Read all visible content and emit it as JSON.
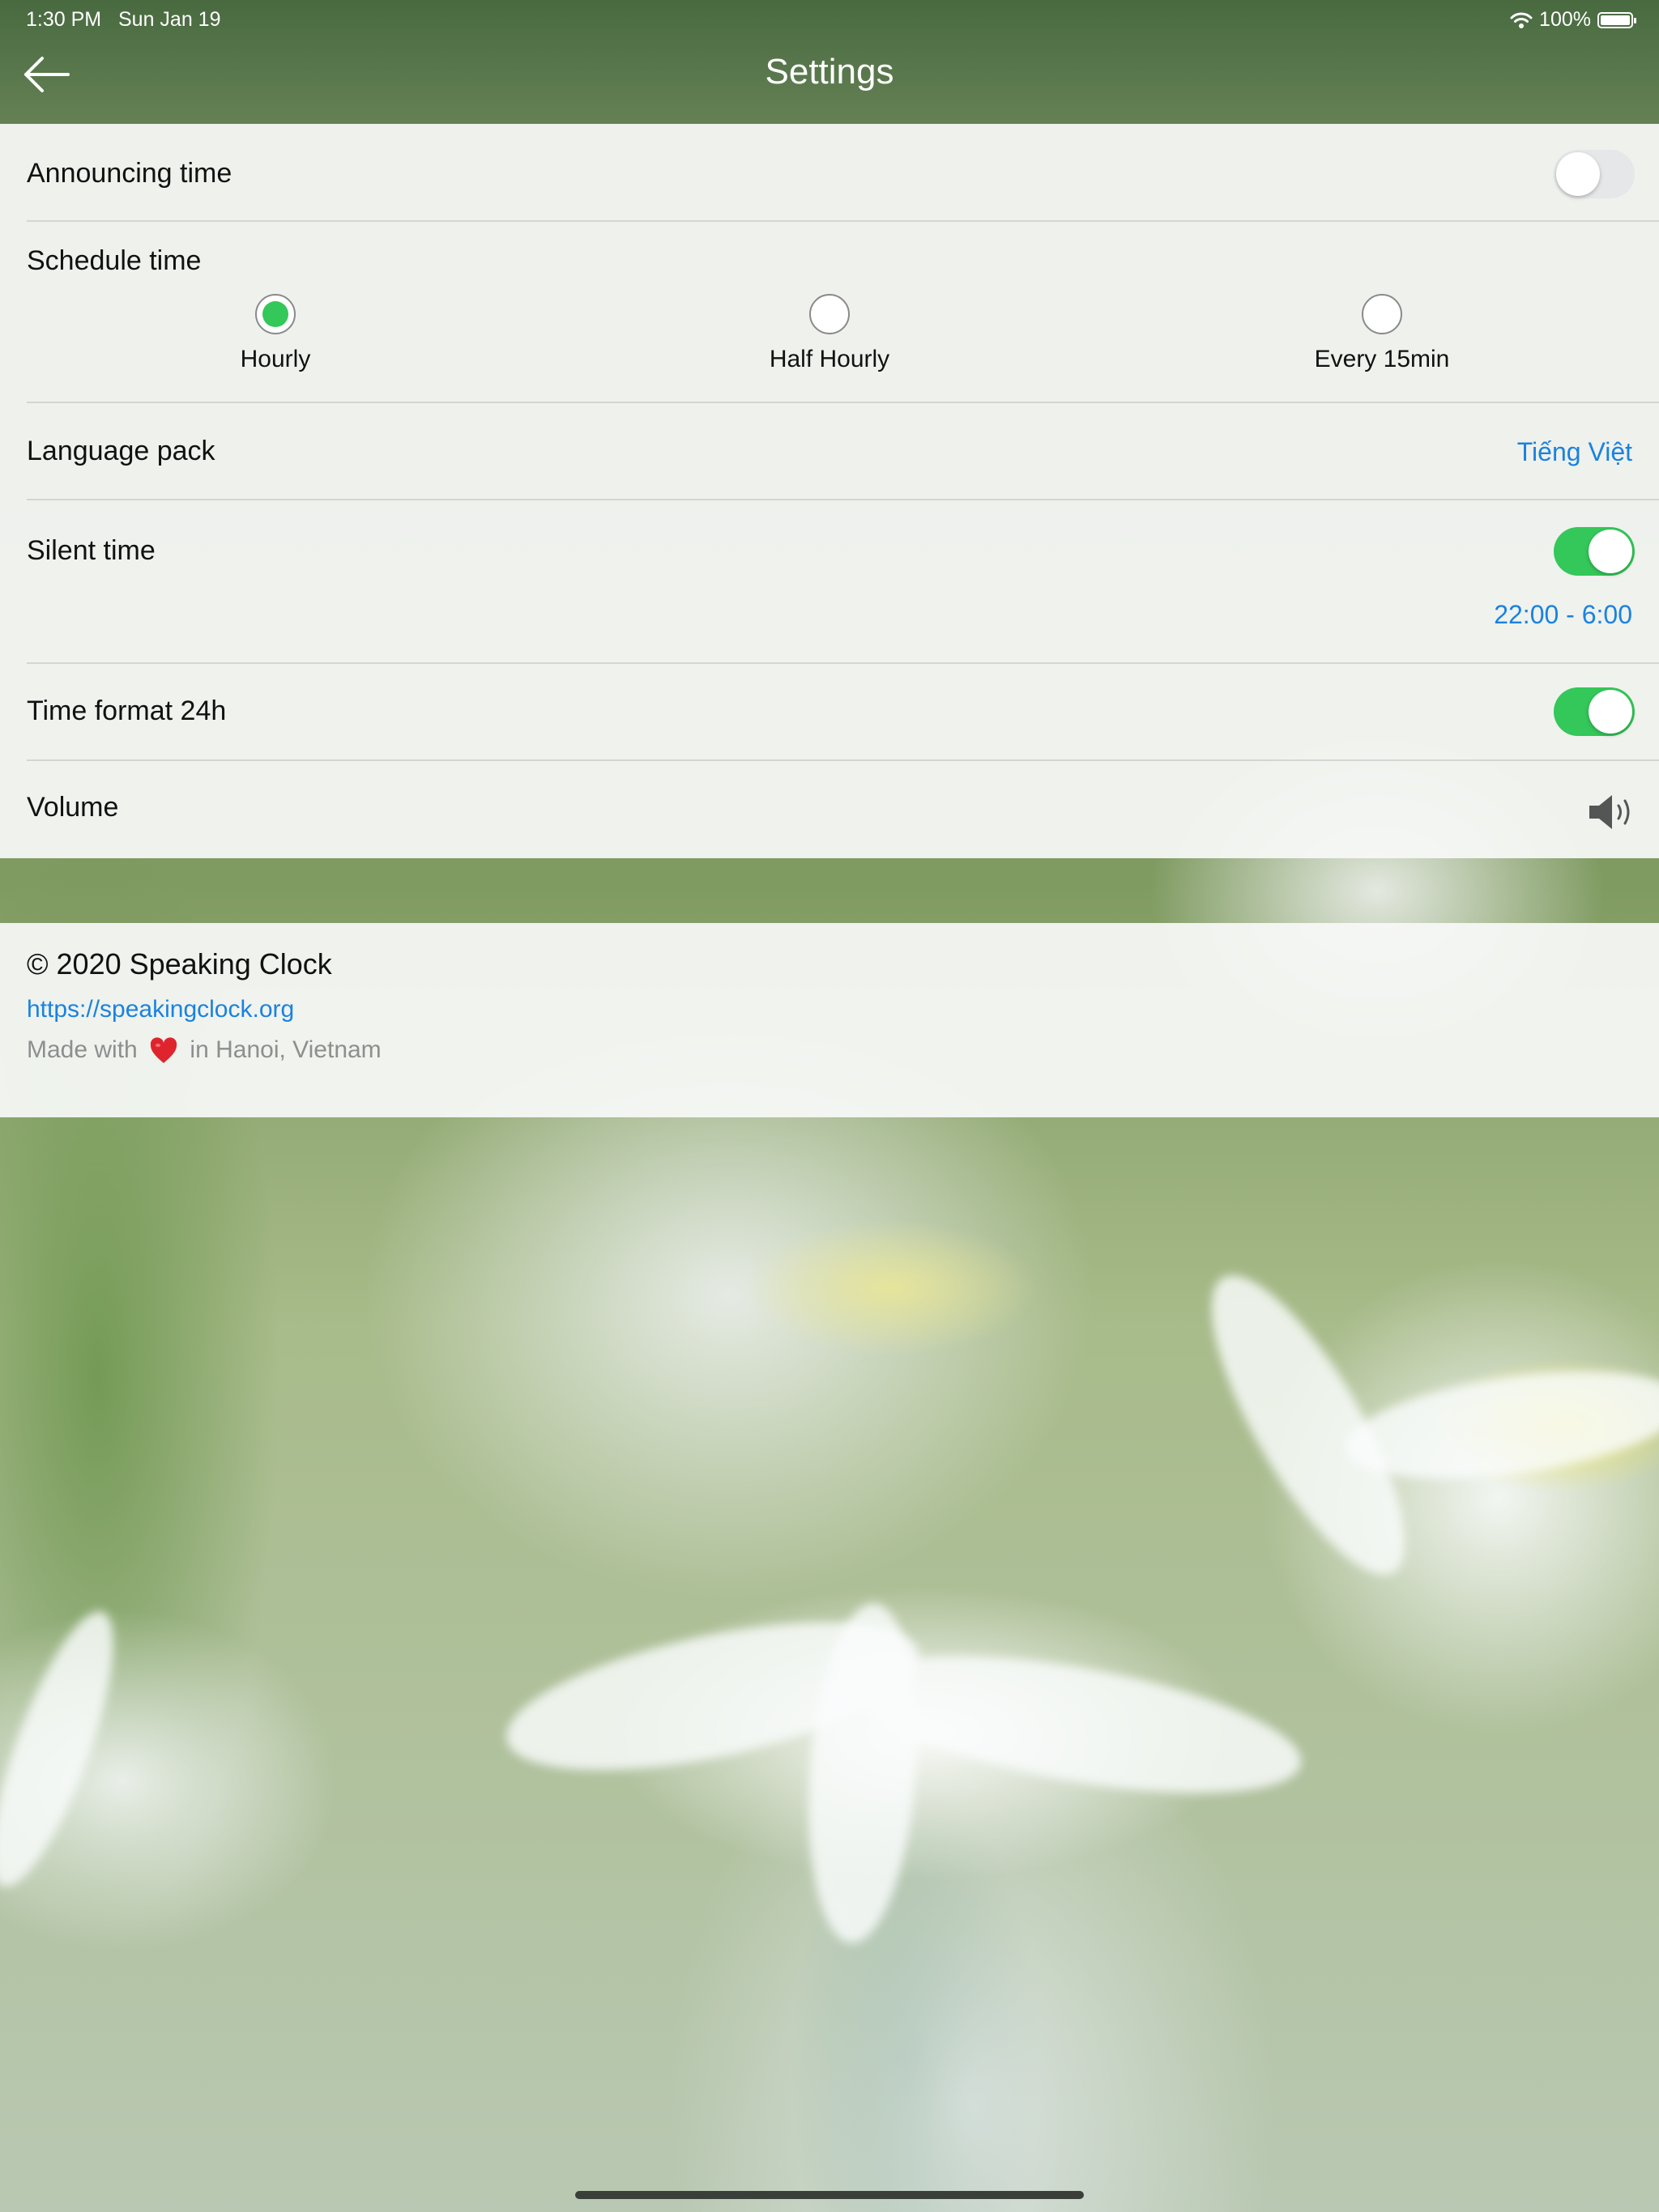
{
  "status_bar": {
    "time": "1:30 PM",
    "date": "Sun Jan 19",
    "battery": "100%"
  },
  "nav": {
    "title": "Settings"
  },
  "settings": {
    "announcing": {
      "label": "Announcing time",
      "enabled": false
    },
    "schedule": {
      "label": "Schedule time",
      "options": [
        {
          "label": "Hourly",
          "selected": true
        },
        {
          "label": "Half Hourly",
          "selected": false
        },
        {
          "label": "Every 15min",
          "selected": false
        }
      ]
    },
    "language": {
      "label": "Language pack",
      "value": "Tiếng Việt"
    },
    "silent": {
      "label": "Silent time",
      "enabled": true,
      "range": "22:00 - 6:00"
    },
    "format": {
      "label": "Time format 24h",
      "enabled": true
    },
    "volume": {
      "label": "Volume"
    }
  },
  "footer": {
    "copyright": "© 2020 Speaking Clock",
    "url": "https://speakingclock.org",
    "made_prefix": "Made with",
    "made_suffix": "in Hanoi, Vietnam"
  },
  "colors": {
    "accent": "#34c759",
    "link": "#1a82e0"
  },
  "icons": [
    "back-arrow-icon",
    "wifi-icon",
    "battery-icon",
    "speaker-icon",
    "heart-icon"
  ]
}
